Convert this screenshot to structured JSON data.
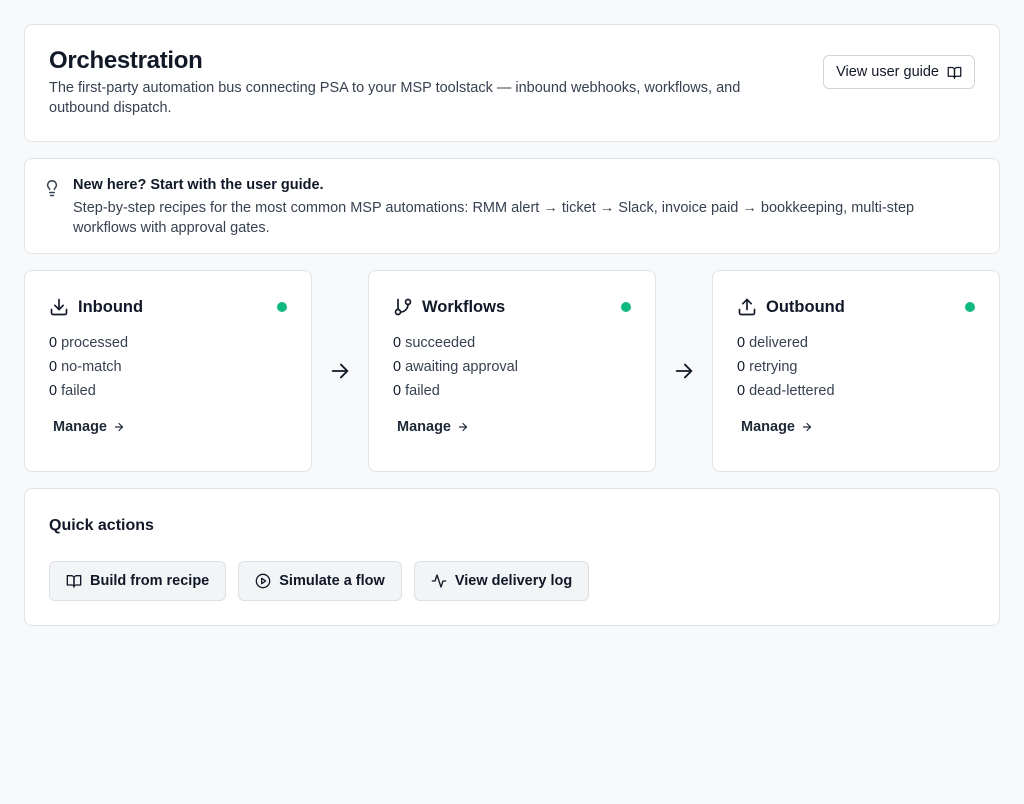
{
  "header": {
    "title": "Orchestration",
    "description": "The first-party automation bus connecting PSA to your MSP toolstack — inbound webhooks, workflows, and outbound dispatch.",
    "guide_button": "View user guide"
  },
  "tip": {
    "title": "New here? Start with the user guide.",
    "body": "Step-by-step recipes for the most common MSP automations: RMM alert → ticket → Slack, invoice paid → bookkeeping, multi-step workflows with approval gates."
  },
  "pipeline": [
    {
      "title": "Inbound",
      "icon": "download-icon",
      "status_color": "#10b981",
      "stats": [
        {
          "value": "0",
          "label": "processed"
        },
        {
          "value": "0",
          "label": "no-match"
        },
        {
          "value": "0",
          "label": "failed"
        }
      ],
      "manage": "Manage"
    },
    {
      "title": "Workflows",
      "icon": "git-branch-icon",
      "status_color": "#10b981",
      "stats": [
        {
          "value": "0",
          "label": "succeeded"
        },
        {
          "value": "0",
          "label": "awaiting approval"
        },
        {
          "value": "0",
          "label": "failed"
        }
      ],
      "manage": "Manage"
    },
    {
      "title": "Outbound",
      "icon": "upload-icon",
      "status_color": "#10b981",
      "stats": [
        {
          "value": "0",
          "label": "delivered"
        },
        {
          "value": "0",
          "label": "retrying"
        },
        {
          "value": "0",
          "label": "dead-lettered"
        }
      ],
      "manage": "Manage"
    }
  ],
  "quick_actions": {
    "title": "Quick actions",
    "buttons": [
      {
        "label": "Build from recipe",
        "icon": "book-open-icon"
      },
      {
        "label": "Simulate a flow",
        "icon": "play-circle-icon"
      },
      {
        "label": "View delivery log",
        "icon": "activity-icon"
      }
    ]
  },
  "colors": {
    "accent_status": "#10b981",
    "background": "#f8f9fa",
    "card_border": "#dfe3e8"
  }
}
